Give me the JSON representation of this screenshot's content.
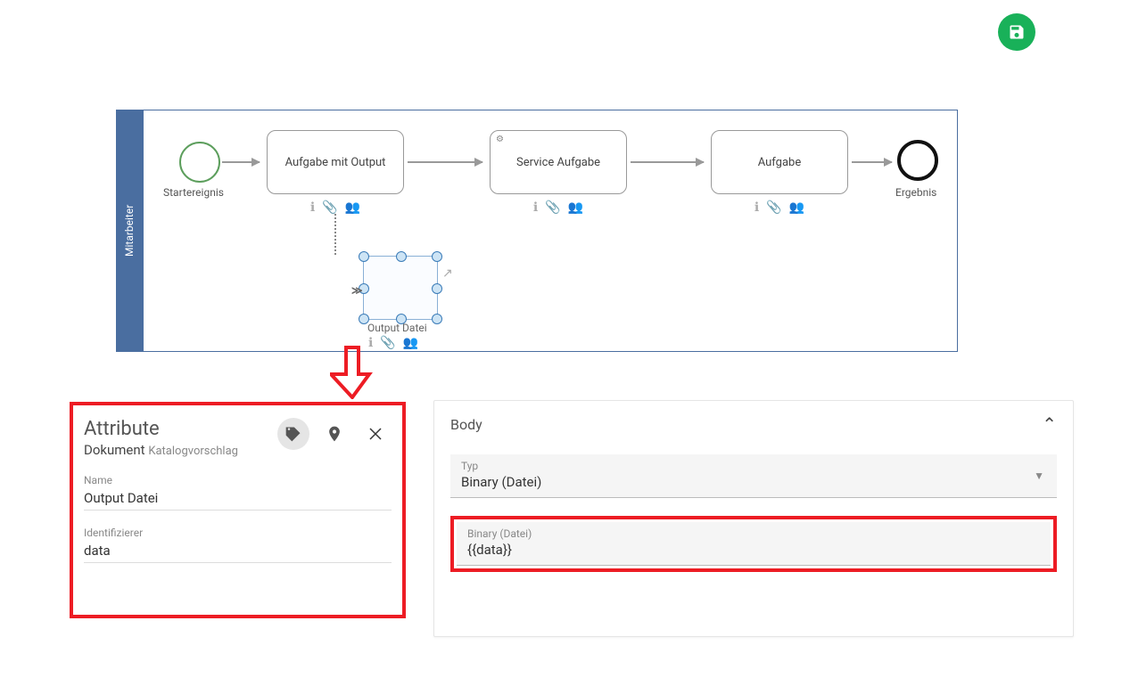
{
  "swimlane": {
    "label": "Mitarbeiter"
  },
  "events": {
    "start": "Startereignis",
    "end": "Ergebnis"
  },
  "tasks": {
    "t1": "Aufgabe mit Output",
    "t2": "Service Aufgabe",
    "t3": "Aufgabe"
  },
  "data_object": {
    "label": "Output Datei"
  },
  "attributes_panel": {
    "title": "Attribute",
    "subtitle_main": "Dokument",
    "subtitle_light": "Katalogvorschlag",
    "name_label": "Name",
    "name_value": "Output Datei",
    "id_label": "Identifizierer",
    "id_value": "data"
  },
  "body_panel": {
    "title": "Body",
    "type_label": "Typ",
    "type_value": "Binary (Datei)",
    "binary_label": "Binary (Datei)",
    "binary_value": "{{data}}"
  }
}
